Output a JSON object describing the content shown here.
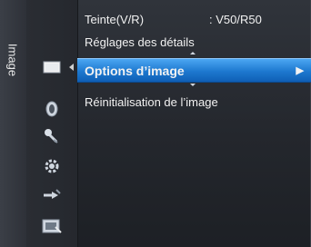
{
  "sidebar": {
    "category_label": "Image",
    "icons": [
      {
        "name": "picture-icon"
      },
      {
        "name": "sound-icon"
      },
      {
        "name": "channel-icon"
      },
      {
        "name": "setup-icon"
      },
      {
        "name": "input-icon"
      },
      {
        "name": "application-icon"
      }
    ]
  },
  "menu": {
    "items": [
      {
        "label": "Teinte(V/R)",
        "value": ": V50/R50"
      },
      {
        "label": "Réglages des détails",
        "value": ""
      },
      {
        "label": "Options d’image",
        "value": "",
        "arrow": "▶"
      },
      {
        "label": "Réinitialisation de l’image",
        "value": ""
      }
    ]
  },
  "colors": {
    "selection_top": "#4ba6f2",
    "selection_bottom": "#0f5fb5",
    "background": "#24272d"
  }
}
